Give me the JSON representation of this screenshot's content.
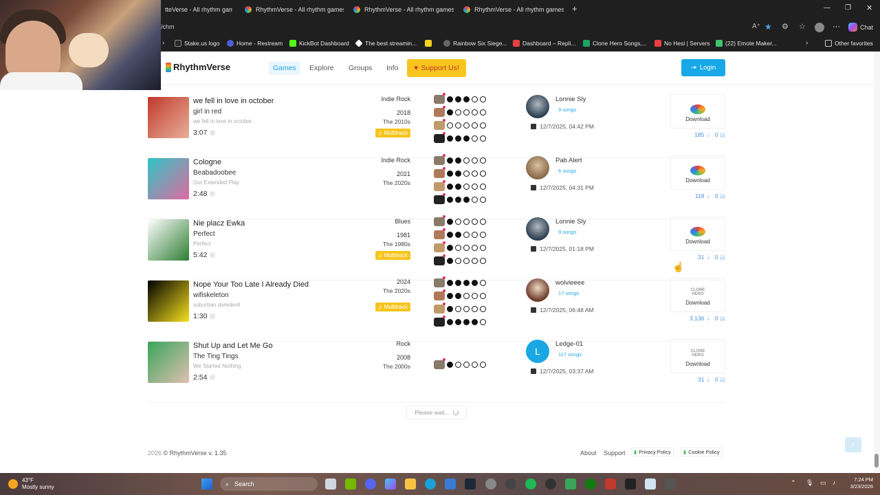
{
  "browser": {
    "tabs": [
      {
        "label": "tteVerse - All rhythm games c"
      },
      {
        "label": "RhythmVerse - All rhythm games c"
      },
      {
        "label": "RhythmVerse - All rhythm games c"
      },
      {
        "label": "RhythmVerse - All rhythm games c"
      }
    ],
    "new_tab": "+",
    "url": "/chm",
    "bookmarks": [
      {
        "label": "Stake.us logo",
        "color": "#2a2a2a"
      },
      {
        "label": "Home - Restream",
        "color": "#4a5fd8"
      },
      {
        "label": "KickBot Dashboard",
        "color": "#53fc18"
      },
      {
        "label": "The best streamin...",
        "color": "#ffffff"
      },
      {
        "label": "",
        "color": "#f7d31e"
      },
      {
        "label": "Rainbow Six Siege...",
        "color": "#666666"
      },
      {
        "label": "Dashboard – Repli...",
        "color": "#e94040"
      },
      {
        "label": "Clone Hero Songs,...",
        "color": "#1fa463"
      },
      {
        "label": "No Hesi | Servers",
        "color": "#e94040"
      },
      {
        "label": "(22) Emote Maker...",
        "color": "#3ec46d"
      }
    ],
    "other_favorites": "Other favorites",
    "chat": "Chat"
  },
  "site": {
    "logo": "RhythmVerse",
    "nav": [
      "Games",
      "Explore",
      "Groups",
      "Info"
    ],
    "support": "Support Us!",
    "login": "Login"
  },
  "songs": [
    {
      "title": "we fell in love in october",
      "artist": "girl in red",
      "album": "we fell in love in october",
      "length": "3:07",
      "genre": "Indie Rock",
      "year": "2018",
      "decade": "The 2010s",
      "multitrack": "Multitrack",
      "diffs": [
        3,
        1,
        0,
        3
      ],
      "uploader": "Lonnie Sly",
      "songs": "9 songs",
      "date": "12/7/2025, 04:42 PM",
      "download": "Download",
      "downloads": "185",
      "comments": "0",
      "icon": "rv",
      "cover": [
        "#c0392b",
        "#e8b09a"
      ],
      "avatar": [
        "#2c3e50",
        "#b0b8c0"
      ]
    },
    {
      "title": "Cologne",
      "artist": "Beabadoobee",
      "album": "Our Extended Play",
      "length": "2:48",
      "genre": "Indie Rock",
      "year": "2021",
      "decade": "The 2020s",
      "multitrack": "",
      "diffs": [
        2,
        2,
        2,
        3
      ],
      "uploader": "Pab Alert",
      "songs": "6 songs",
      "date": "12/7/2025, 04:31 PM",
      "download": "Download",
      "downloads": "118",
      "comments": "0",
      "icon": "rv",
      "cover": [
        "#2ec4c4",
        "#e06aa0"
      ],
      "avatar": [
        "#8a6a4a",
        "#d8c0a0"
      ]
    },
    {
      "title": "Nie placz Ewka",
      "artist": "Perfect",
      "album": "Perfect",
      "length": "5:42",
      "genre": "Blues",
      "year": "1981",
      "decade": "The 1980s",
      "multitrack": "Multitrack",
      "diffs": [
        1,
        2,
        1,
        1
      ],
      "uploader": "Lonnie Sly",
      "songs": "9 songs",
      "date": "12/7/2025, 01:18 PM",
      "download": "Download",
      "downloads": "31",
      "comments": "0",
      "icon": "rv",
      "cover": [
        "#ffffff",
        "#2e7d32"
      ],
      "avatar": [
        "#2c3e50",
        "#b0b8c0"
      ]
    },
    {
      "title": "Nope Your Too Late I Already Died",
      "artist": "wifiskeleton",
      "album": "suburban daredevil",
      "length": "1:30",
      "genre": "",
      "year": "2024",
      "decade": "The 2020s",
      "multitrack": "Multitrack",
      "diffs": [
        4,
        2,
        1,
        4
      ],
      "uploader": "wolvieeee",
      "songs": "17 songs",
      "date": "12/7/2025, 06:48 AM",
      "download": "Download",
      "downloads": "3,136",
      "comments": "0",
      "icon": "ch",
      "cover": [
        "#000000",
        "#f7e11e"
      ],
      "avatar": [
        "#6a3a2a",
        "#f0d8c0"
      ]
    },
    {
      "title": "Shut Up and Let Me Go",
      "artist": "The Ting Tings",
      "album": "We Started Nothing",
      "length": "2:54",
      "genre": "Rock",
      "year": "2008",
      "decade": "The 2000s",
      "multitrack": "",
      "diffs": [
        1
      ],
      "uploader": "Ledge-01",
      "songs": "117 songs",
      "date": "12/7/2025, 03:37 AM",
      "download": "Download",
      "downloads": "31",
      "comments": "0",
      "icon": "ch",
      "cover": [
        "#3aa55a",
        "#e0c0b0"
      ],
      "avatar": "L"
    }
  ],
  "loading": "Please wait...",
  "footer": {
    "copyright_year": "2026",
    "copyright": "© RhythmVerse v. 1.35",
    "links": [
      "About",
      "Support"
    ],
    "privacy": "Privacy Policy",
    "cookie": "Cookie Policy"
  },
  "taskbar": {
    "temp": "43°F",
    "weather": "Mostly sunny",
    "search": "Search",
    "time": "7:24 PM",
    "date": "3/23/2026"
  },
  "colors": {
    "accent": "#1ea7e4",
    "support": "#f7c51e",
    "multitrack": "#f7c51e"
  }
}
